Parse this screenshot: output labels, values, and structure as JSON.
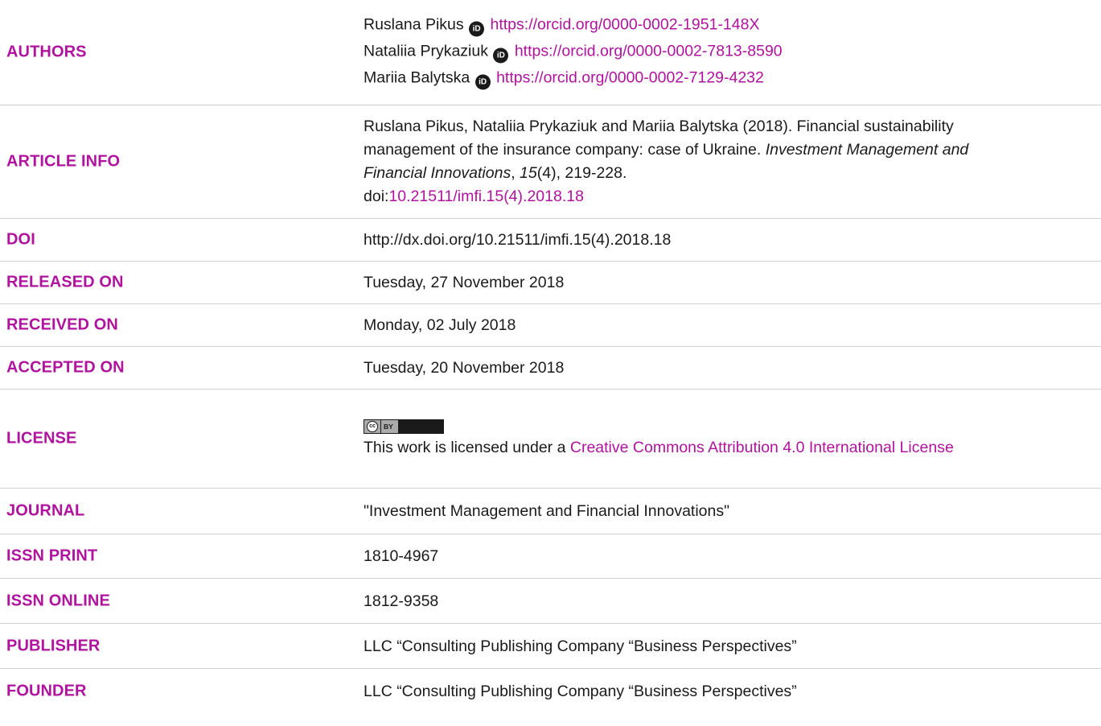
{
  "authors": {
    "label": "AUTHORS",
    "list": [
      {
        "name": "Ruslana Pikus",
        "orcid": "https://orcid.org/0000-0002-1951-148X"
      },
      {
        "name": "Nataliia Prykaziuk",
        "orcid": "https://orcid.org/0000-0002-7813-8590"
      },
      {
        "name": "Mariia Balytska",
        "orcid": "https://orcid.org/0000-0002-7129-4232"
      }
    ],
    "orcid_badge": "iD"
  },
  "article_info": {
    "label": "ARTICLE INFO",
    "citation_start": "Ruslana Pikus, Nataliia Prykaziuk and Mariia Balytska (2018). Financial sustainability management of the insurance company: case of Ukraine.",
    "journal_italic": "Investment Management and Financial Innovations",
    "sep1": ", ",
    "volume_italic": "15",
    "issue_pages": "(4), 219-228.",
    "doi_prefix": "doi:",
    "doi_link": "10.21511/imfi.15(4).2018.18"
  },
  "doi": {
    "label": "DOI",
    "value": "http://dx.doi.org/10.21511/imfi.15(4).2018.18"
  },
  "released": {
    "label": "RELEASED ON",
    "value": "Tuesday, 27 November 2018"
  },
  "received": {
    "label": "RECEIVED ON",
    "value": "Monday, 02 July 2018"
  },
  "accepted": {
    "label": "ACCEPTED ON",
    "value": "Tuesday, 20 November 2018"
  },
  "license": {
    "label": "LICENSE",
    "badge_cc": "cc",
    "badge_by": "BY",
    "text_prefix": "This work is licensed under a ",
    "link_text": "Creative Commons Attribution 4.0 International License"
  },
  "journal": {
    "label": "JOURNAL",
    "value": "\"Investment Management and Financial Innovations\""
  },
  "issn_print": {
    "label": "ISSN PRINT",
    "value": "1810-4967"
  },
  "issn_online": {
    "label": "ISSN ONLINE",
    "value": "1812-9358"
  },
  "publisher": {
    "label": "PUBLISHER",
    "value": "LLC “Consulting Publishing Company “Business Perspectives”"
  },
  "founder": {
    "label": "FOUNDER",
    "value": "LLC “Consulting Publishing Company “Business Perspectives”"
  },
  "colors": {
    "accent": "#b0139e",
    "text": "#1a1a1a",
    "divider": "#cfcfcf"
  }
}
